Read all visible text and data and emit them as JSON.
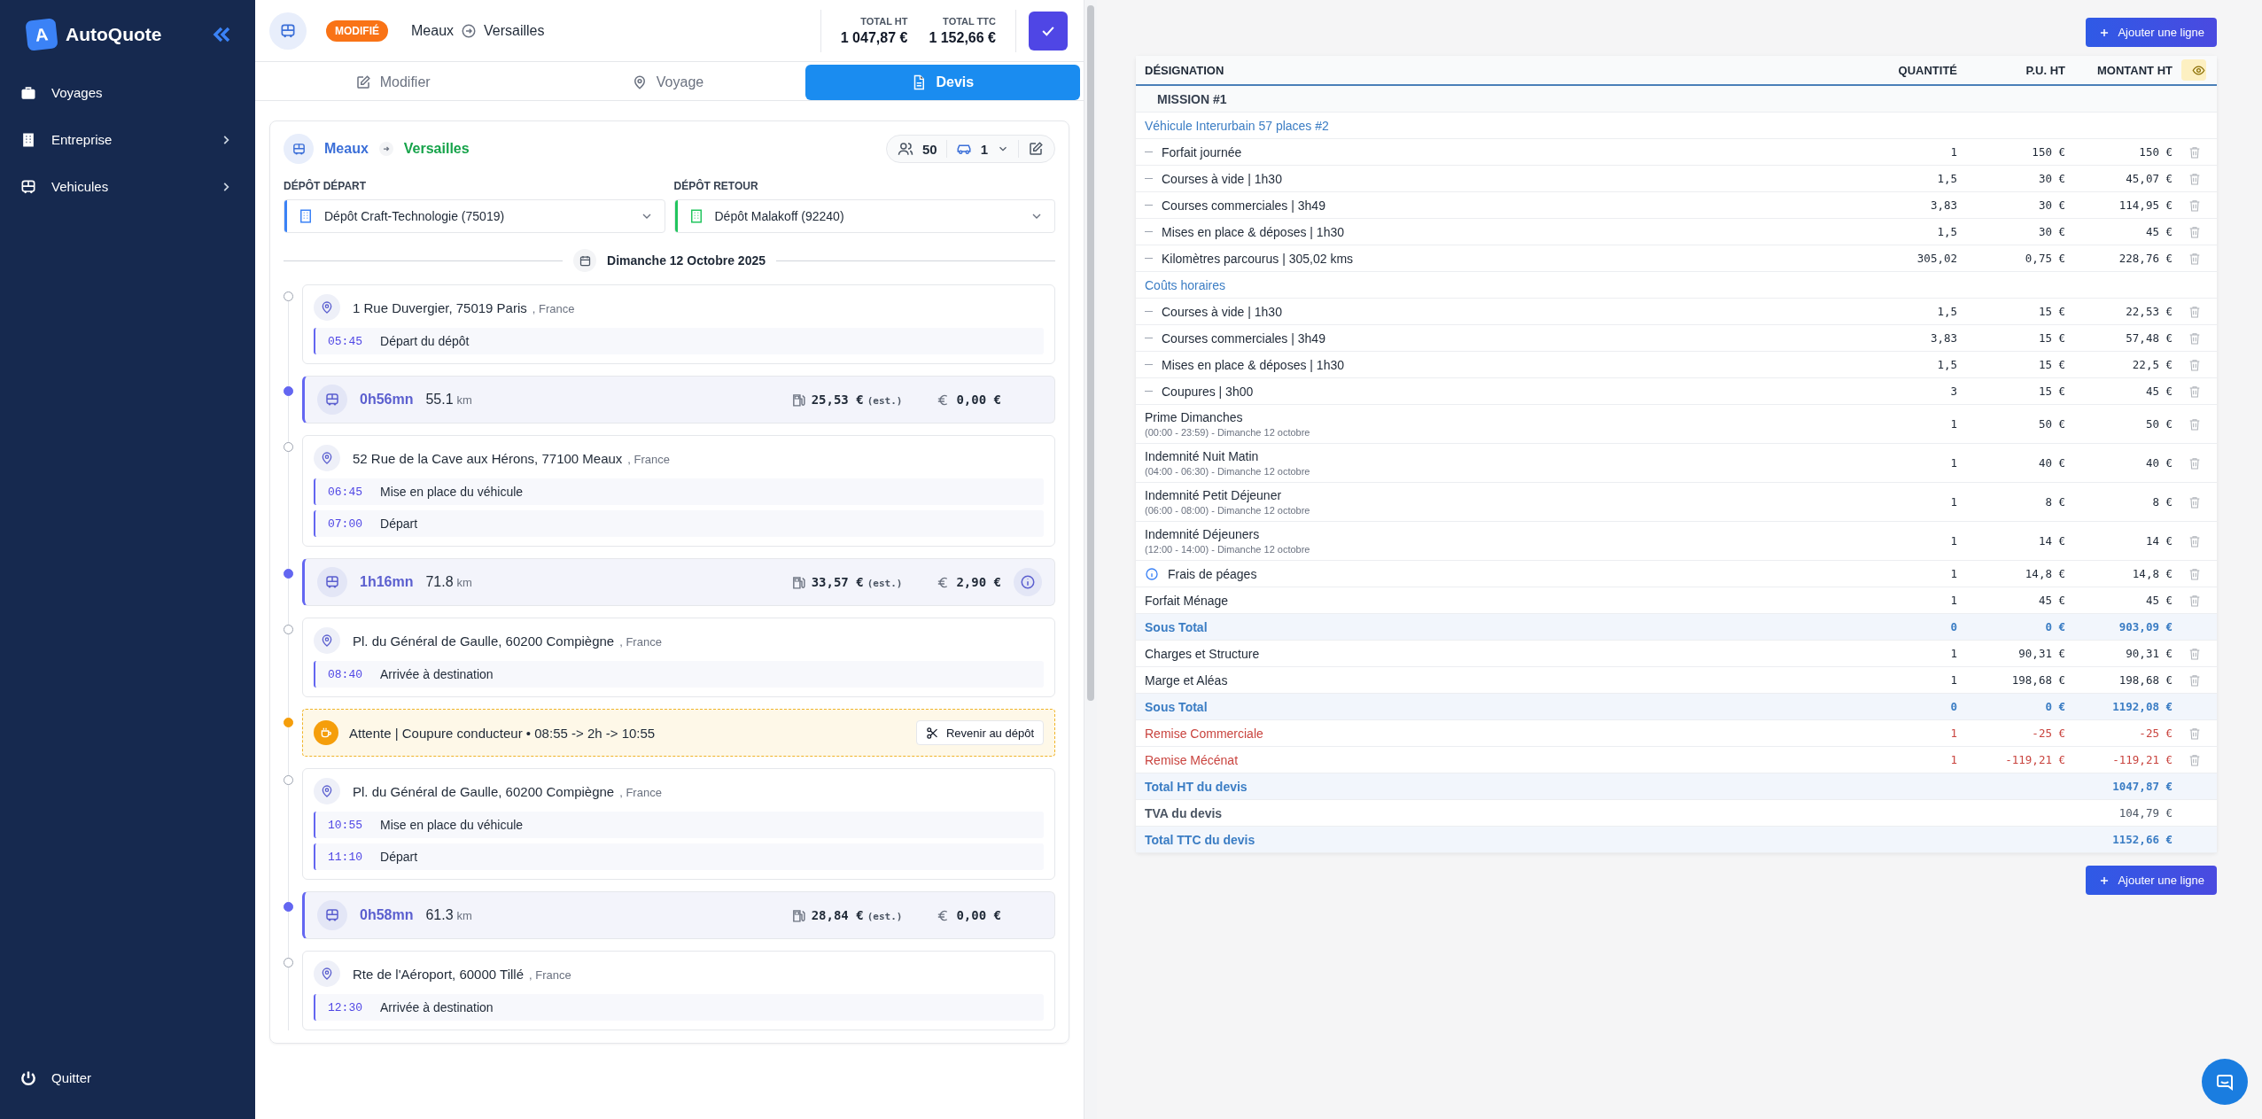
{
  "sidebar": {
    "logo_letter": "A",
    "brand": "AutoQuote",
    "items": [
      {
        "label": "Voyages",
        "expandable": false
      },
      {
        "label": "Entreprise",
        "expandable": true
      },
      {
        "label": "Vehicules",
        "expandable": true
      }
    ],
    "footer": "Quitter"
  },
  "header": {
    "status": "MODIFIÉ",
    "from": "Meaux",
    "to": "Versailles",
    "totals": [
      {
        "label": "TOTAL HT",
        "value": "1 047,87 €"
      },
      {
        "label": "TOTAL TTC",
        "value": "1 152,66 €"
      }
    ]
  },
  "tabs": [
    {
      "label": "Modifier",
      "selected": false
    },
    {
      "label": "Voyage",
      "selected": false
    },
    {
      "label": "Devis",
      "selected": true
    }
  ],
  "trip": {
    "from": "Meaux",
    "to": "Versailles",
    "passengers": "50",
    "vehicles": "1",
    "depots": [
      {
        "label": "DÉPÔT DÉPART",
        "value": "Dépôt Craft-Technologie (75019)",
        "color": "#3b82f6"
      },
      {
        "label": "DÉPÔT RETOUR",
        "value": "Dépôt Malakoff (92240)",
        "color": "#22c55e"
      }
    ],
    "date": "Dimanche 12 Octobre 2025",
    "timeline": [
      {
        "kind": "stop",
        "address": "1 Rue Duvergier, 75019 Paris",
        "country": ", France",
        "events": [
          {
            "time": "05:45",
            "label": "Départ du dépôt"
          }
        ]
      },
      {
        "kind": "drive",
        "duration": "0h56mn",
        "distance": "55.1",
        "unit": "km",
        "fuel": "25,53 €",
        "fuel_note": "(est.)",
        "toll": "0,00 €",
        "info": false
      },
      {
        "kind": "stop",
        "address": "52 Rue de la Cave aux Hérons, 77100 Meaux",
        "country": ", France",
        "events": [
          {
            "time": "06:45",
            "label": "Mise en place du véhicule"
          },
          {
            "time": "07:00",
            "label": "Départ"
          }
        ]
      },
      {
        "kind": "drive",
        "duration": "1h16mn",
        "distance": "71.8",
        "unit": "km",
        "fuel": "33,57 €",
        "fuel_note": "(est.)",
        "toll": "2,90 €",
        "info": true
      },
      {
        "kind": "stop",
        "address": "Pl. du Général de Gaulle, 60200 Compiègne",
        "country": ", France",
        "events": [
          {
            "time": "08:40",
            "label": "Arrivée à destination"
          }
        ]
      },
      {
        "kind": "wait",
        "text": "Attente | Coupure conducteur • 08:55 -> 2h -> 10:55",
        "action": "Revenir au dépôt"
      },
      {
        "kind": "stop",
        "address": "Pl. du Général de Gaulle, 60200 Compiègne",
        "country": ", France",
        "events": [
          {
            "time": "10:55",
            "label": "Mise en place du véhicule"
          },
          {
            "time": "11:10",
            "label": "Départ"
          }
        ]
      },
      {
        "kind": "drive",
        "duration": "0h58mn",
        "distance": "61.3",
        "unit": "km",
        "fuel": "28,84 €",
        "fuel_note": "(est.)",
        "toll": "0,00 €",
        "info": false
      },
      {
        "kind": "stop",
        "address": "Rte de l'Aéroport, 60000 Tillé",
        "country": ", France",
        "events": [
          {
            "time": "12:30",
            "label": "Arrivée à destination"
          }
        ]
      }
    ]
  },
  "quote": {
    "add_label_top": "Ajouter une ligne",
    "add_label_bottom": "Ajouter une ligne",
    "columns": [
      "DÉSIGNATION",
      "QUANTITÉ",
      "P.U. HT",
      "MONTANT HT"
    ],
    "rows": [
      {
        "kind": "section",
        "label": "MISSION #1"
      },
      {
        "kind": "group",
        "label": "Véhicule Interurbain 57 places #2"
      },
      {
        "kind": "line",
        "dash": true,
        "label": "Forfait journée",
        "qty": "1",
        "unit": "150 €",
        "amount": "150 €"
      },
      {
        "kind": "line",
        "dash": true,
        "label": "Courses à vide | 1h30",
        "qty": "1,5",
        "unit": "30 €",
        "amount": "45,07 €"
      },
      {
        "kind": "line",
        "dash": true,
        "label": "Courses commerciales | 3h49",
        "qty": "3,83",
        "unit": "30 €",
        "amount": "114,95 €"
      },
      {
        "kind": "line",
        "dash": true,
        "label": "Mises en place & déposes | 1h30",
        "qty": "1,5",
        "unit": "30 €",
        "amount": "45 €"
      },
      {
        "kind": "line",
        "dash": true,
        "label": "Kilomètres parcourus | 305,02 kms",
        "qty": "305,02",
        "unit": "0,75 €",
        "amount": "228,76 €"
      },
      {
        "kind": "group",
        "label": "Coûts horaires"
      },
      {
        "kind": "line",
        "dash": true,
        "label": "Courses à vide | 1h30",
        "qty": "1,5",
        "unit": "15 €",
        "amount": "22,53 €"
      },
      {
        "kind": "line",
        "dash": true,
        "label": "Courses commerciales | 3h49",
        "qty": "3,83",
        "unit": "15 €",
        "amount": "57,48 €"
      },
      {
        "kind": "line",
        "dash": true,
        "label": "Mises en place & déposes | 1h30",
        "qty": "1,5",
        "unit": "15 €",
        "amount": "22,5 €"
      },
      {
        "kind": "line",
        "dash": true,
        "label": "Coupures | 3h00",
        "qty": "3",
        "unit": "15 €",
        "amount": "45 €"
      },
      {
        "kind": "line",
        "label": "Prime Dimanches",
        "sub": "(00:00 - 23:59) - Dimanche 12 octobre",
        "qty": "1",
        "unit": "50 €",
        "amount": "50 €"
      },
      {
        "kind": "line",
        "label": "Indemnité Nuit Matin",
        "sub": "(04:00 - 06:30) - Dimanche 12 octobre",
        "qty": "1",
        "unit": "40 €",
        "amount": "40 €"
      },
      {
        "kind": "line",
        "label": "Indemnité Petit Déjeuner",
        "sub": "(06:00 - 08:00) - Dimanche 12 octobre",
        "qty": "1",
        "unit": "8 €",
        "amount": "8 €"
      },
      {
        "kind": "line",
        "label": "Indemnité Déjeuners",
        "sub": "(12:00 - 14:00) - Dimanche 12 octobre",
        "qty": "1",
        "unit": "14 €",
        "amount": "14 €"
      },
      {
        "kind": "line",
        "info": true,
        "label": "Frais de péages",
        "qty": "1",
        "unit": "14,8 €",
        "amount": "14,8 €"
      },
      {
        "kind": "line",
        "label": "Forfait Ménage",
        "qty": "1",
        "unit": "45 €",
        "amount": "45 €"
      },
      {
        "kind": "subtotal",
        "label": "Sous Total",
        "qty": "0",
        "unit": "0 €",
        "amount": "903,09 €"
      },
      {
        "kind": "line",
        "label": "Charges et Structure",
        "qty": "1",
        "unit": "90,31 €",
        "amount": "90,31 €"
      },
      {
        "kind": "line",
        "label": "Marge et Aléas",
        "qty": "1",
        "unit": "198,68 €",
        "amount": "198,68 €"
      },
      {
        "kind": "subtotal",
        "label": "Sous Total",
        "qty": "0",
        "unit": "0 €",
        "amount": "1192,08 €"
      },
      {
        "kind": "discount",
        "label": "Remise Commerciale",
        "qty": "1",
        "unit": "-25 €",
        "amount": "-25 €"
      },
      {
        "kind": "discount",
        "label": "Remise Mécénat",
        "qty": "1",
        "unit": "-119,21 €",
        "amount": "-119,21 €"
      },
      {
        "kind": "total",
        "label": "Total HT du devis",
        "amount": "1047,87 €"
      },
      {
        "kind": "tax",
        "label": "TVA du devis",
        "amount": "104,79 €"
      },
      {
        "kind": "total",
        "label": "Total TTC du devis",
        "amount": "1152,66 €"
      }
    ]
  }
}
